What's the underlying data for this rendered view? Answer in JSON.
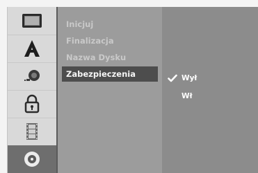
{
  "sidebar": {
    "icons": [
      {
        "name": "tv-screen-icon"
      },
      {
        "name": "letter-a-icon"
      },
      {
        "name": "audio-speaker-icon"
      },
      {
        "name": "padlock-icon"
      },
      {
        "name": "film-strip-icon"
      },
      {
        "name": "disc-icon",
        "active": true
      }
    ]
  },
  "menu": {
    "items": [
      {
        "label": "Inicjuj"
      },
      {
        "label": "Finalizacja"
      },
      {
        "label": "Nazwa Dysku"
      },
      {
        "label": "Zabezpieczenia",
        "selected": true
      }
    ]
  },
  "options": {
    "items": [
      {
        "label": "Wył",
        "checked": true
      },
      {
        "label": "Wł",
        "checked": false
      }
    ]
  },
  "colors": {
    "selected_menu_bg": "#4d4d4d",
    "menu_panel_bg": "#9c9c9c",
    "options_panel_bg": "#8c8c8c",
    "active_icon_bg": "#6e6e6e"
  }
}
